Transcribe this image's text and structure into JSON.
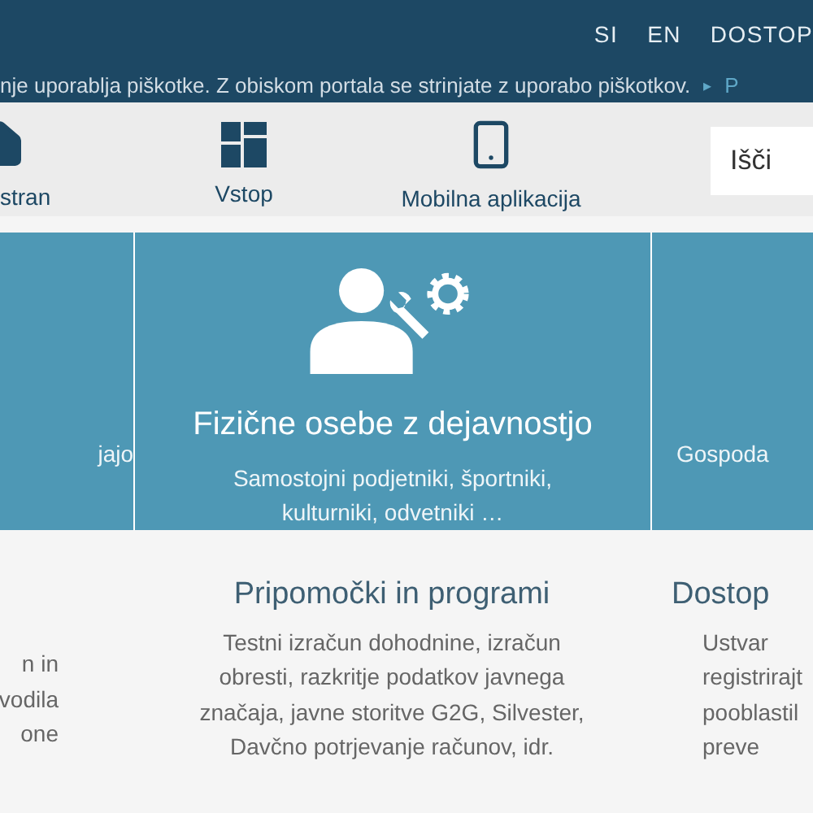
{
  "top_links": [
    {
      "label": "SI"
    },
    {
      "label": "EN"
    },
    {
      "label": "DOSTOP"
    }
  ],
  "cookie_notice": {
    "text": "nje uporablja piškotke. Z obiskom portala se strinjate z uporabo piškotkov.",
    "link_arrow": "▸",
    "link": "P"
  },
  "nav": [
    {
      "label": "stran"
    },
    {
      "label": "Vstop"
    },
    {
      "label": "Mobilna aplikacija"
    }
  ],
  "search": {
    "placeholder": "Išči"
  },
  "tiles": [
    {
      "lines": [
        "jajo"
      ]
    },
    {
      "title": "Fizične osebe z dejavnostjo",
      "text": "Samostojni podjetniki, športniki, kulturniki, odvetniki …"
    },
    {
      "lines": [
        "Gospoda"
      ]
    }
  ],
  "sections": [
    {
      "lines": [
        "n in",
        "vodila",
        "one"
      ]
    },
    {
      "title": "Pripomočki in programi",
      "text": "Testni izračun dohodnine, izračun obresti, razkritje podatkov javnega značaja, javne storitve G2G, Silvester, Davčno potrjevanje računov, idr."
    },
    {
      "title": "Dostop",
      "lines": [
        "Ustvar",
        "registrirajt",
        "pooblastil",
        "preve"
      ]
    }
  ]
}
